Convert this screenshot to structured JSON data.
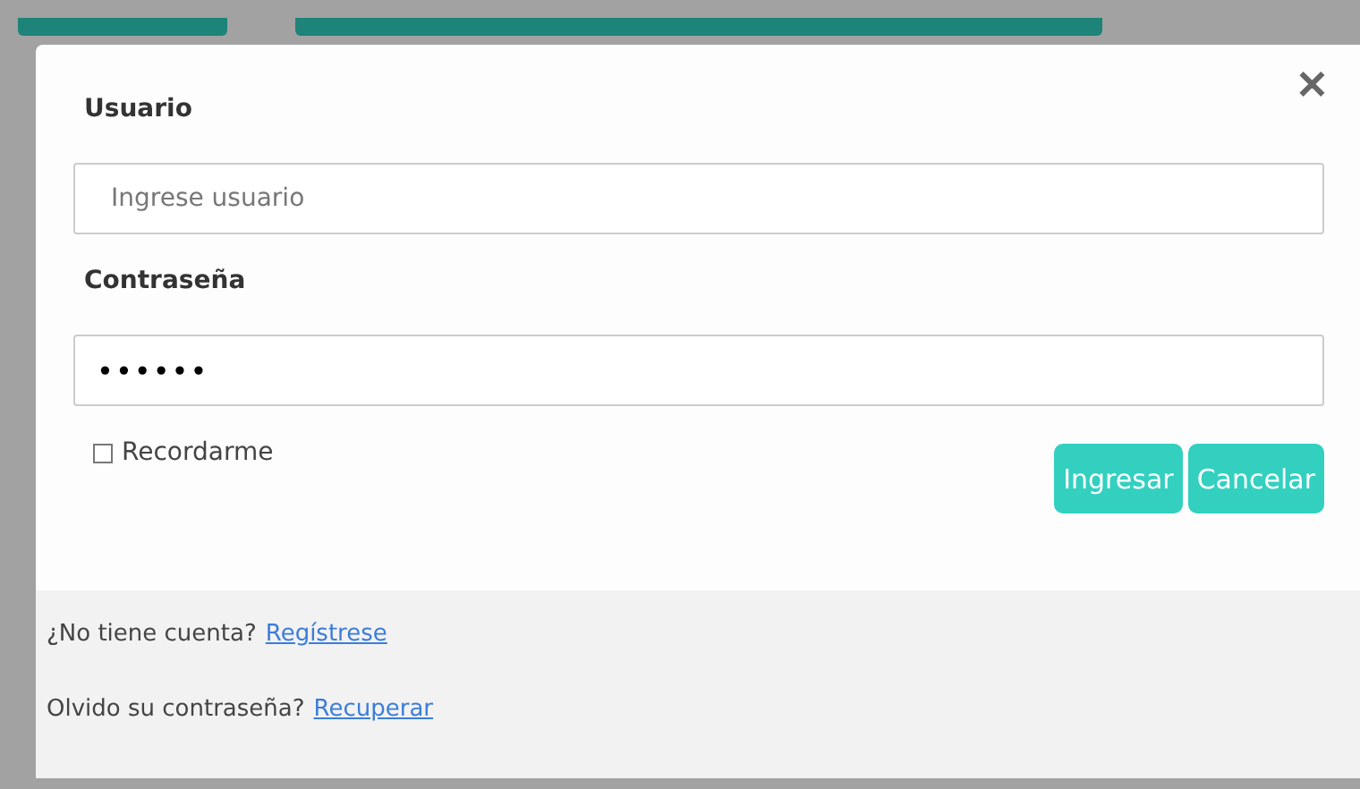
{
  "login": {
    "username_label": "Usuario",
    "username": {
      "placeholder": "Ingrese usuario"
    },
    "password_label": "Contraseña",
    "password": {
      "value": "••••••"
    },
    "remember": {
      "label": "Recordarme",
      "checked": false
    },
    "close": "✕",
    "buttons": [
      "Ingresar",
      "Cancelar"
    ]
  },
  "footer": [
    {
      "text": "¿No tiene cuenta?",
      "link": "Regístrese"
    },
    {
      "text": "Olvido su contraseña?",
      "link": "Recuperar"
    }
  ]
}
